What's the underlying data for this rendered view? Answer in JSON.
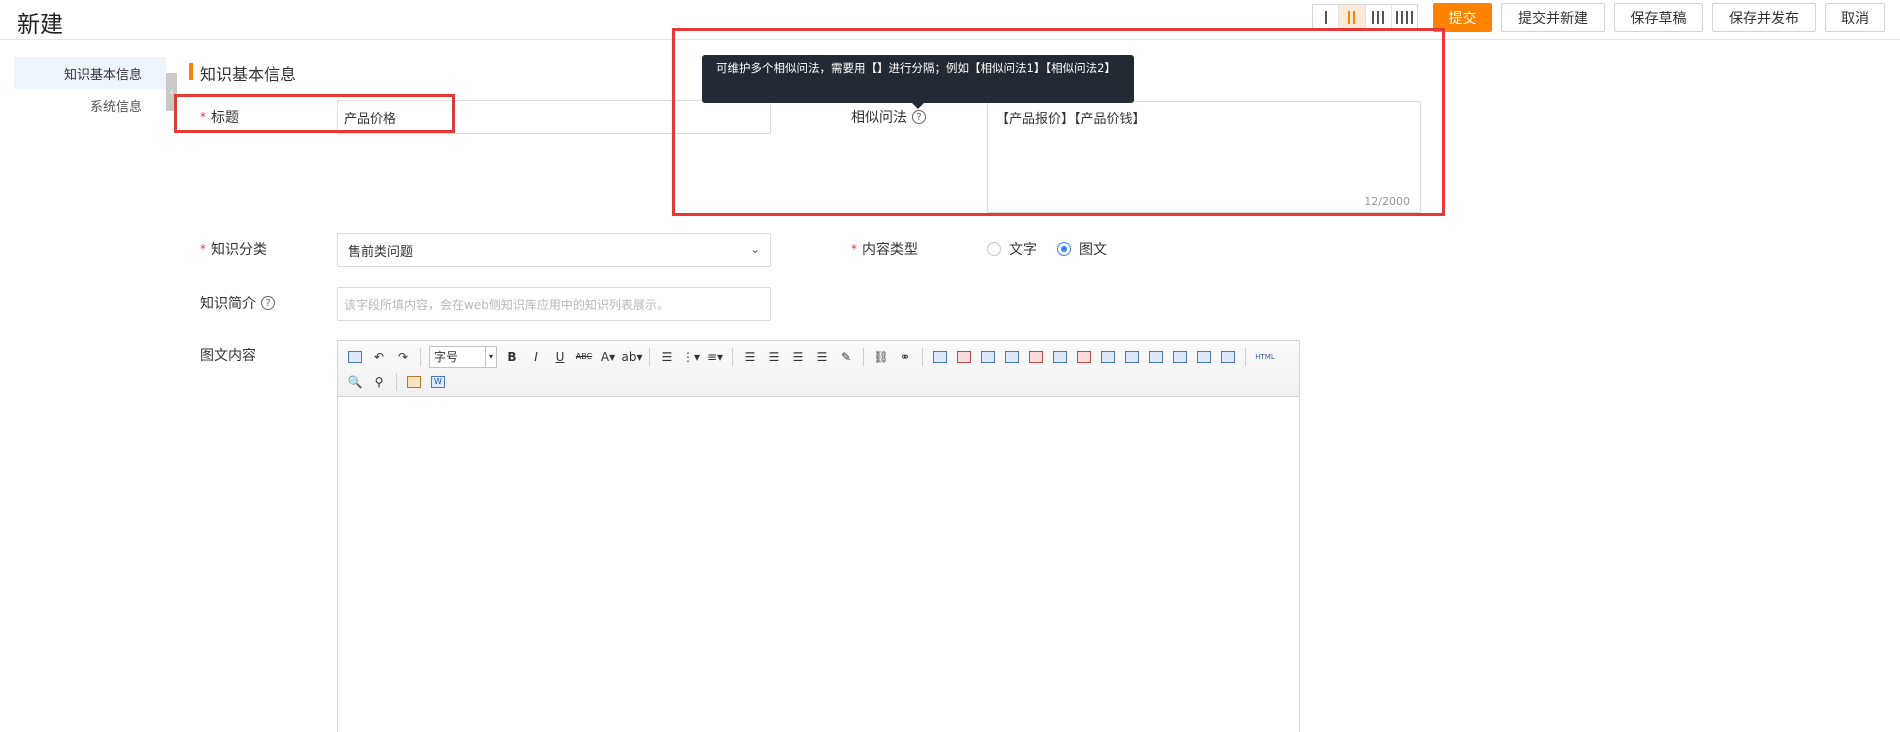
{
  "header": {
    "title": "新建",
    "buttons": {
      "submit": "提交",
      "submit_and_new": "提交并新建",
      "save_draft": "保存草稿",
      "save_and_publish": "保存并发布",
      "cancel": "取消"
    },
    "column_layouts": [
      1,
      2,
      3,
      4
    ],
    "active_column_layout": 2
  },
  "sidebar": {
    "items": [
      {
        "label": "知识基本信息",
        "active": true
      },
      {
        "label": "系统信息",
        "active": false
      }
    ]
  },
  "section": {
    "title": "知识基本信息"
  },
  "form": {
    "title_label": "标题",
    "title_value": "产品价格",
    "similar_label": "相似问法",
    "similar_value": "【产品报价】【产品价钱】",
    "similar_counter": "12/2000",
    "category_label": "知识分类",
    "category_value": "售前类问题",
    "content_type_label": "内容类型",
    "content_type_options": [
      "文字",
      "图文"
    ],
    "content_type_selected": "图文",
    "intro_label": "知识简介",
    "intro_placeholder": "该字段所填内容，会在web侧知识库应用中的知识列表展示。",
    "content_label": "图文内容"
  },
  "tooltip": {
    "text": "可维护多个相似问法，需要用【】进行分隔；例如【相似问法1】【相似问法2】"
  },
  "editor": {
    "font_size_label": "字号",
    "html_label": "HTML"
  },
  "colors": {
    "accent": "#ff8200",
    "radio_selected": "#3b82f6",
    "annotation": "#e53935",
    "tooltip_bg": "#222a33"
  }
}
